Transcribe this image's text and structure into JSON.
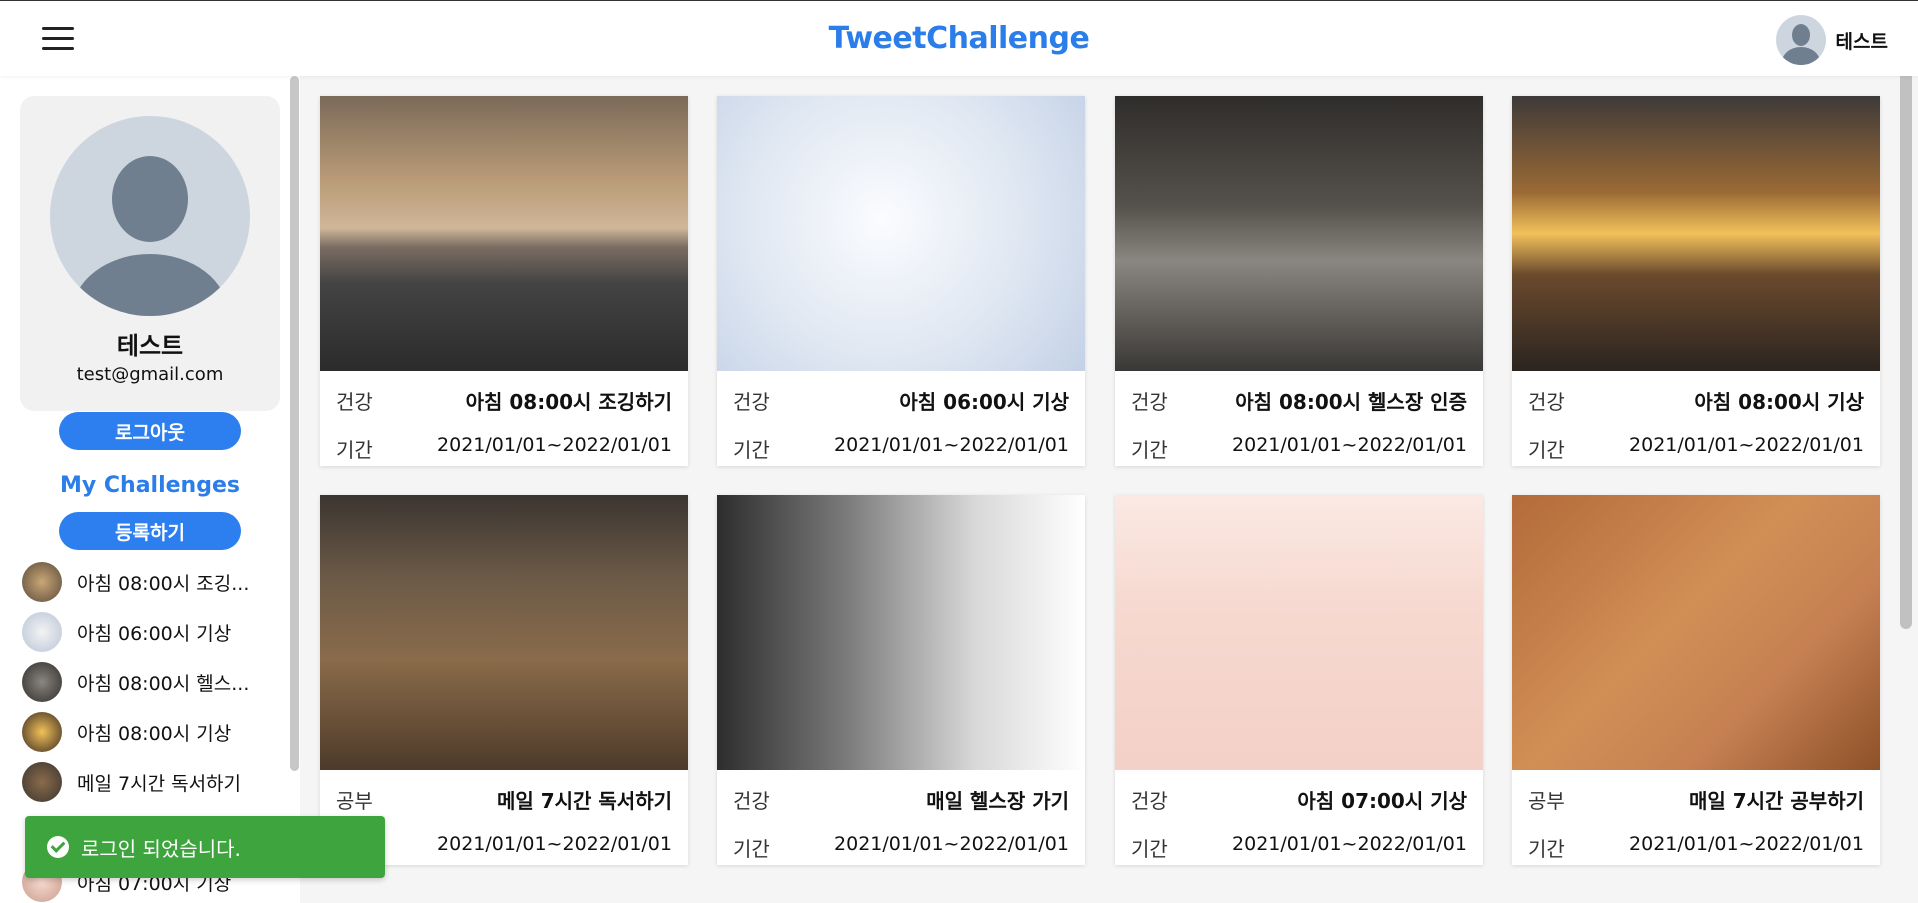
{
  "header": {
    "brand": "TweetChallenge",
    "user_name": "테스트",
    "menu_icon": "hamburger-icon",
    "avatar_icon": "user-avatar-icon"
  },
  "sidebar": {
    "profile": {
      "name": "테스트",
      "email": "test@gmail.com"
    },
    "logout_label": "로그아웃",
    "my_challenges_title": "My Challenges",
    "register_label": "등록하기",
    "items": [
      {
        "label": "아침 08:00시 조깅..."
      },
      {
        "label": "아침 06:00시 기상"
      },
      {
        "label": "아침 08:00시 헬스..."
      },
      {
        "label": "아침 08:00시 기상"
      },
      {
        "label": "메일 7시간 독서하기"
      },
      {
        "label": "아침 07:00시 기상"
      }
    ]
  },
  "toast": {
    "message": "로그인 되었습니다.",
    "icon": "check-circle-icon"
  },
  "period_label": "기간",
  "cards": [
    {
      "category": "건강",
      "title": "아침 08:00시 조깅하기",
      "dates": "2021/01/01~2022/01/01"
    },
    {
      "category": "건강",
      "title": "아침 06:00시 기상",
      "dates": "2021/01/01~2022/01/01"
    },
    {
      "category": "건강",
      "title": "아침 08:00시 헬스장 인증",
      "dates": "2021/01/01~2022/01/01"
    },
    {
      "category": "건강",
      "title": "아침 08:00시 기상",
      "dates": "2021/01/01~2022/01/01"
    },
    {
      "category": "공부",
      "title": "메일 7시간 독서하기",
      "dates": "2021/01/01~2022/01/01"
    },
    {
      "category": "건강",
      "title": "매일 헬스장 가기",
      "dates": "2021/01/01~2022/01/01"
    },
    {
      "category": "건강",
      "title": "아침 07:00시 기상",
      "dates": "2021/01/01~2022/01/01"
    },
    {
      "category": "공부",
      "title": "매일 7시간 공부하기",
      "dates": "2021/01/01~2022/01/01"
    }
  ],
  "colors": {
    "brand": "#2b7de9",
    "button": "#2d7ff0",
    "toast": "#3ea43d"
  }
}
